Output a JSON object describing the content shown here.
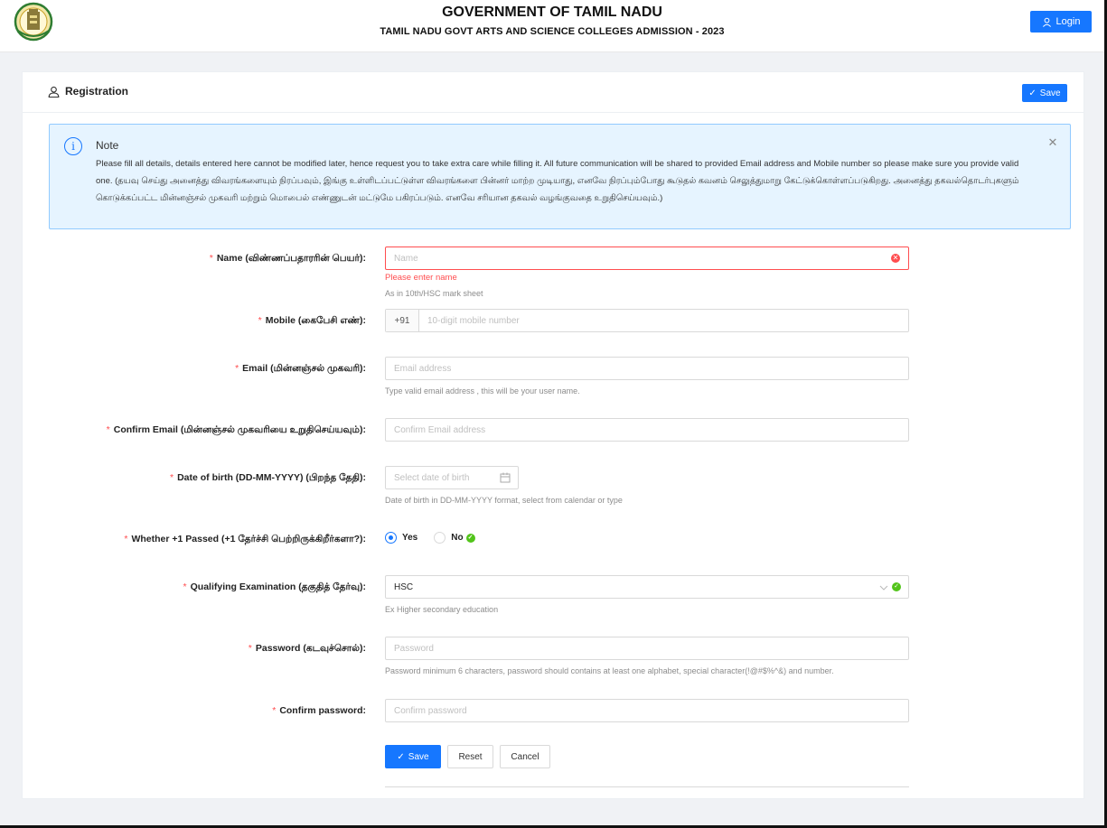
{
  "header": {
    "title": "GOVERNMENT OF TAMIL NADU",
    "subtitle": "TAMIL NADU GOVT ARTS AND SCIENCE COLLEGES ADMISSION - 2023",
    "login_label": "Login",
    "logo_icon": "tamil-nadu-emblem-icon"
  },
  "card": {
    "title": "Registration",
    "header_save_label": "Save"
  },
  "note": {
    "title": "Note",
    "text": "Please fill all details, details entered here cannot be modified later, hence request you to take extra care while filling it. All future communication will be shared to provided Email address and Mobile number so please make sure you provide valid one. (தயவு செய்து அனைத்து விவரங்களையும் நிரப்பவும், இங்கு உள்ளிடப்பட்டுள்ள விவரங்களை பின்னர் மாற்ற முடியாது, எனவே நிரப்பும்போது கூடுதல் கவனம் செலுத்துமாறு கேட்டுக்கொள்ளப்படுகிறது. அனைத்து தகவல்தொடர்புகளும் கொடுக்கப்பட்ட மின்னஞ்சல் முகவரி மற்றும் மொபைல் எண்ணுடன் மட்டுமே பகிரப்படும். எனவே சரியான தகவல் வழங்குவதை உறுதிசெய்யவும்.)"
  },
  "form": {
    "name": {
      "label": "Name (விண்ணப்பதாரரின் பெயர்):",
      "placeholder": "Name",
      "error": "Please enter name",
      "help": "As in 10th/HSC mark sheet"
    },
    "mobile": {
      "label": "Mobile (கைபேசி எண்):",
      "prefix": "+91",
      "placeholder": "10-digit mobile number"
    },
    "email": {
      "label": "Email (மின்னஞ்சல் முகவரி):",
      "placeholder": "Email address",
      "help": "Type valid email address , this will be your user name."
    },
    "confirm_email": {
      "label": "Confirm Email (மின்னஞ்சல் முகவரியை உறுதிசெய்யவும்):",
      "placeholder": "Confirm Email address"
    },
    "dob": {
      "label": "Date of birth (DD-MM-YYYY) (பிறந்த தேதி):",
      "placeholder": "Select date of birth",
      "help": "Date of birth in DD-MM-YYYY format, select from calendar or type"
    },
    "plus_one": {
      "label": "Whether +1 Passed (+1 தேர்ச்சி பெற்றிருக்கிறீர்களா?):",
      "options": [
        "Yes",
        "No"
      ],
      "selected": "Yes"
    },
    "qualifying": {
      "label": "Qualifying Examination (தகுதித் தேர்வு):",
      "value": "HSC",
      "help": "Ex Higher secondary education"
    },
    "password": {
      "label": "Password (கடவுச்சொல்):",
      "placeholder": "Password",
      "help": "Password minimum 6 characters, password should contains at least one alphabet, special character(!@#$%^&) and number."
    },
    "confirm_password": {
      "label": "Confirm password:",
      "placeholder": "Confirm password"
    }
  },
  "actions": {
    "save_label": "Save",
    "reset_label": "Reset",
    "cancel_label": "Cancel"
  },
  "colors": {
    "primary": "#1677ff",
    "error": "#ff4d4f",
    "success": "#52c41a",
    "alert_bg": "#e6f4ff"
  }
}
